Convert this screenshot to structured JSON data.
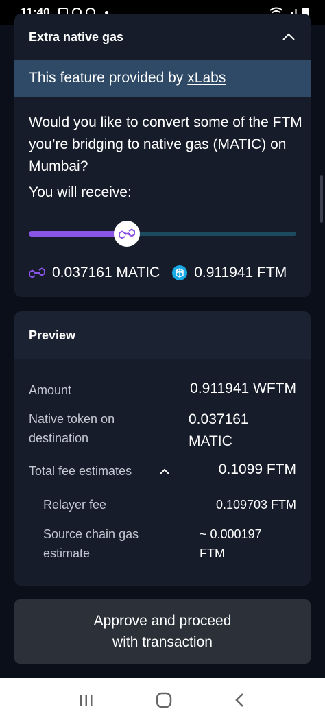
{
  "status_bar": {
    "time": "11:40"
  },
  "extra_gas": {
    "title": "Extra native gas",
    "provided_text": "This feature provided by",
    "provider_link": "xLabs",
    "question": "Would you like to convert some of the FTM you’re bridging to native gas (MATIC) on Mumbai?",
    "receive_label": "You will receive:",
    "slider_fraction": 0.367,
    "matic_amount": "0.037161 MATIC",
    "ftm_amount": "0.911941 FTM"
  },
  "preview": {
    "title": "Preview",
    "amount_label": "Amount",
    "amount_value": "0.911941 WFTM",
    "native_label_1": "Native token on",
    "native_label_2": "destination",
    "native_value_1": "0.037161",
    "native_value_2": "MATIC",
    "fee_label": "Total fee estimates",
    "fee_value": "0.1099 FTM",
    "relayer_label": "Relayer fee",
    "relayer_value": "0.109703 FTM",
    "gas_label_1": "Source chain gas",
    "gas_label_2": "estimate",
    "gas_value_1": "~ 0.000197",
    "gas_value_2": "FTM"
  },
  "action": {
    "line1": "Approve and proceed",
    "line2": "with transaction"
  },
  "colors": {
    "accent_purple": "#8a55e6",
    "track": "#1c4a5e",
    "banner": "#2e4a66",
    "ftm_blue": "#19a9e5"
  },
  "icons": [
    "chevron-up-icon",
    "matic-icon",
    "ftm-icon",
    "recent-apps-icon",
    "home-icon",
    "back-icon"
  ]
}
